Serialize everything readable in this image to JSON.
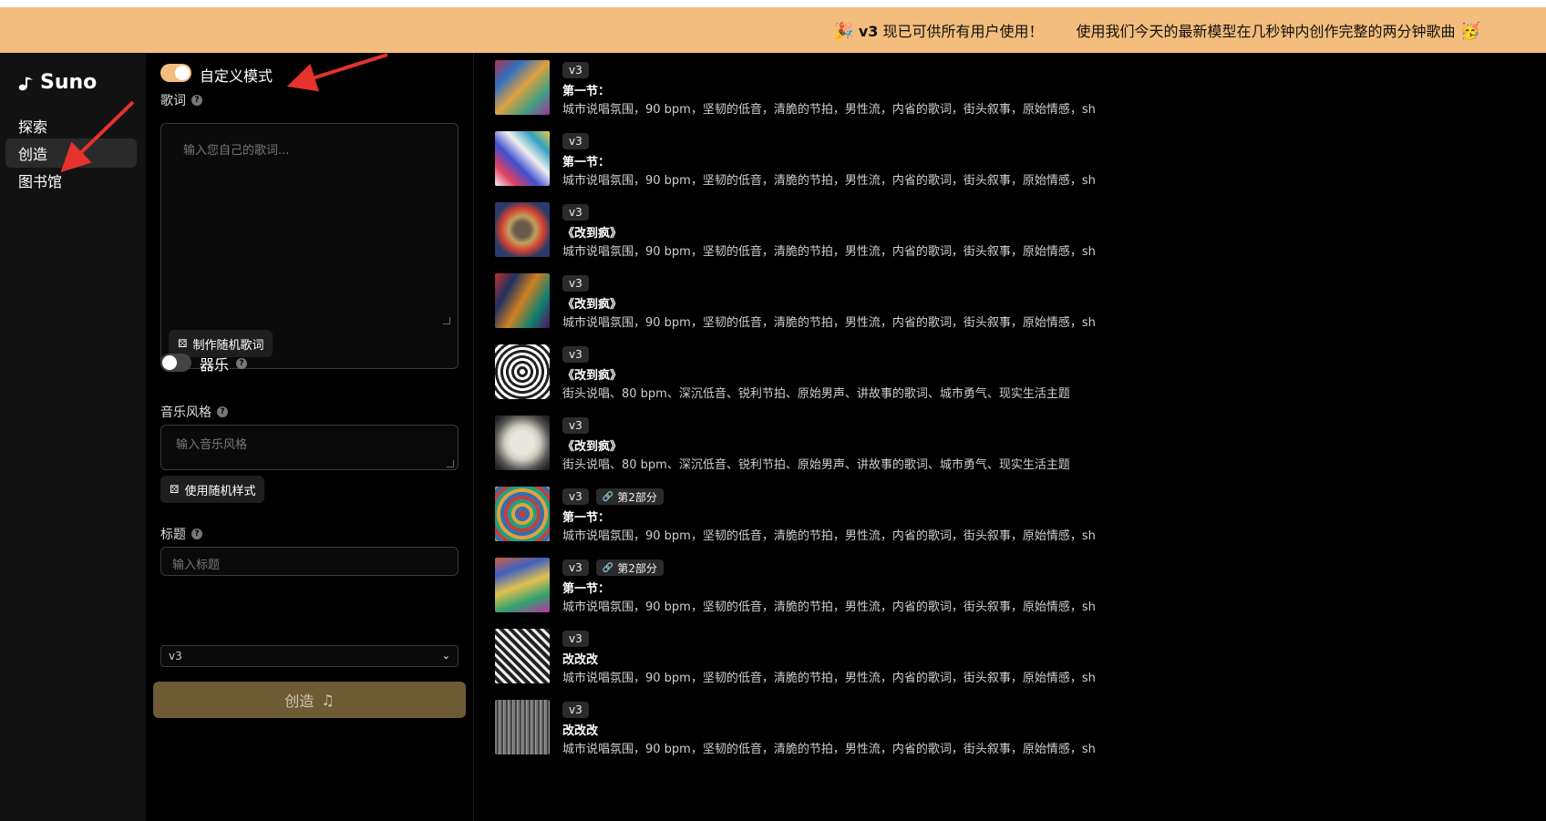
{
  "banner": {
    "part1_emoji": "🎉",
    "part1_bold": "v3",
    "part1_text": " 现已可供所有用户使用！",
    "part2_text": "使用我们今天的最新模型在几秒钟内创作完整的两分钟歌曲",
    "part2_emoji": "🥳"
  },
  "sidebar": {
    "logo": "Suno",
    "items": [
      {
        "label": "探索",
        "active": false
      },
      {
        "label": "创造",
        "active": true
      },
      {
        "label": "图书馆",
        "active": false
      }
    ]
  },
  "form": {
    "custom_mode_label": "自定义模式",
    "custom_mode_on": true,
    "lyrics_label": "歌词",
    "lyrics_placeholder": "输入您自己的歌词...",
    "random_lyrics_button": "制作随机歌词",
    "instrumental_label": "器乐",
    "instrumental_on": false,
    "style_label": "音乐风格",
    "style_placeholder": "输入音乐风格",
    "random_style_button": "使用随机样式",
    "title_label": "标题",
    "title_placeholder": "输入标题",
    "model_value": "v3",
    "create_button": "创造"
  },
  "songs": [
    {
      "version": "v3",
      "extra_badge": "",
      "title": "第一节：",
      "desc": "城市说唱氛围，90 bpm，坚韧的低音，清脆的节拍，男性流，内省的歌词，街头叙事，原始情感，sh",
      "art": "swirl-1"
    },
    {
      "version": "v3",
      "extra_badge": "",
      "title": "第一节：",
      "desc": "城市说唱氛围，90 bpm，坚韧的低音，清脆的节拍，男性流，内省的歌词，街头叙事，原始情感，sh",
      "art": "streaks"
    },
    {
      "version": "v3",
      "extra_badge": "",
      "title": "《改到疯》",
      "desc": "城市说唱氛围，90 bpm，坚韧的低音，清脆的节拍，男性流，内省的歌词，街头叙事，原始情感，sh",
      "art": "face"
    },
    {
      "version": "v3",
      "extra_badge": "",
      "title": "《改到疯》",
      "desc": "城市说唱氛围，90 bpm，坚韧的低音，清脆的节拍，男性流，内省的歌词，街头叙事，原始情感，sh",
      "art": "collage"
    },
    {
      "version": "v3",
      "extra_badge": "",
      "title": "《改到疯》",
      "desc": "街头说唱、80 bpm、深沉低音、锐利节拍、原始男声、讲故事的歌词、城市勇气、现实生活主题",
      "art": "maze-round"
    },
    {
      "version": "v3",
      "extra_badge": "",
      "title": "《改到疯》",
      "desc": "街头说唱、80 bpm、深沉低音、锐利节拍、原始男声、讲故事的歌词、城市勇气、现实生活主题",
      "art": "bee"
    },
    {
      "version": "v3",
      "extra_badge": "第2部分",
      "title": "第一节：",
      "desc": "城市说唱氛围，90 bpm，坚韧的低音，清脆的节拍，男性流，内省的歌词，街头叙事，原始情感，sh",
      "art": "spiral"
    },
    {
      "version": "v3",
      "extra_badge": "第2部分",
      "title": "第一节：",
      "desc": "城市说唱氛围，90 bpm，坚韧的低音，清脆的节拍，男性流，内省的歌词，街头叙事，原始情感，sh",
      "art": "swirl-2"
    },
    {
      "version": "v3",
      "extra_badge": "",
      "title": "改改改",
      "desc": "城市说唱氛围，90 bpm，坚韧的低音，清脆的节拍，男性流，内省的歌词，街头叙事，原始情感，sh",
      "art": "maze-diag"
    },
    {
      "version": "v3",
      "extra_badge": "",
      "title": "改改改",
      "desc": "城市说唱氛围，90 bpm，坚韧的低音，清脆的节拍，男性流，内省的歌词，街头叙事，原始情感，sh",
      "art": "texture"
    }
  ],
  "colors": {
    "banner": "#f2bd7d",
    "toggle_on": "#f2bd7d",
    "create_button": "#6e5a35",
    "annotation_arrow": "#e5322d"
  }
}
